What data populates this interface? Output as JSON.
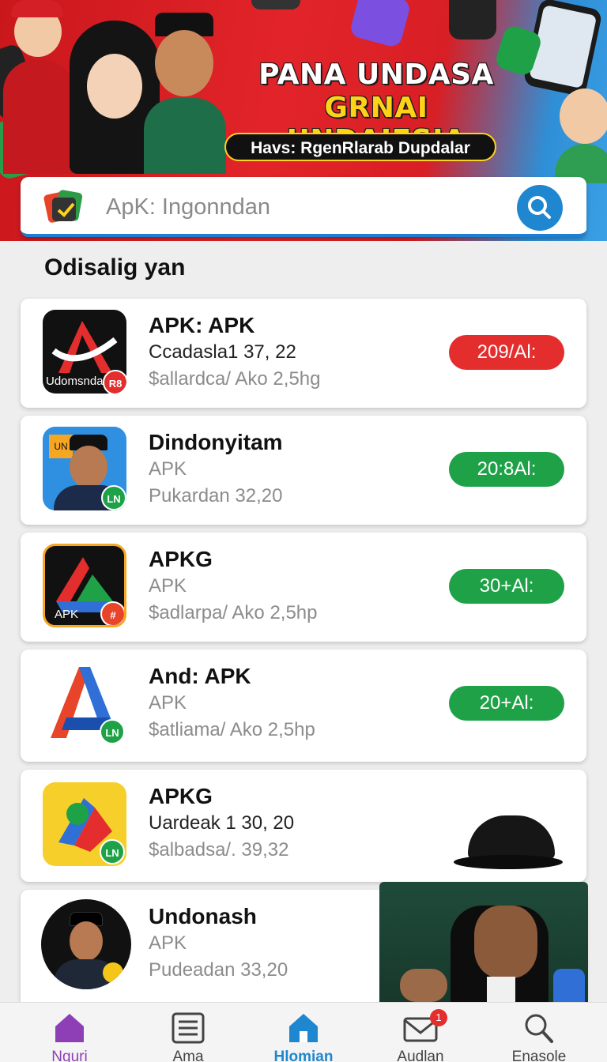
{
  "banner": {
    "title_line1": "PANA UNDASA",
    "title_line2": "GRNAI UNDAIESIA",
    "pill_text": "Havs: RgenRlarab Dupdalar"
  },
  "search": {
    "placeholder": "ApK: Ingonndan",
    "icon": "search-icon"
  },
  "section": {
    "title": "Odisalig yan"
  },
  "apps": [
    {
      "name": "APK: APK",
      "sub": "Ccadasla1 37, 22",
      "meta": "$allardca/ Ako 2,5hg",
      "action": "209/Al:",
      "action_color": "#e42d2d",
      "icon_label": "Udomsnda",
      "badge": "R8"
    },
    {
      "name": "Dindonyitam",
      "sub": "APK",
      "meta": "Pukardan 32,20",
      "action": "20:8Al:",
      "action_color": "#1fa247",
      "icon_label": "UN",
      "badge": "LN"
    },
    {
      "name": "APKG",
      "sub": "APK",
      "meta": "$adlarpa/ Ako 2,5hp",
      "action": "30+Al:",
      "action_color": "#1fa247",
      "icon_label": "APK",
      "badge": "#"
    },
    {
      "name": "And: APK",
      "sub": "APK",
      "meta": "$atliama/ Ako 2,5hp",
      "action": "20+Al:",
      "action_color": "#1fa247",
      "icon_label": "",
      "badge": "LN"
    },
    {
      "name": "APKG",
      "sub": "Uardeak 1 30, 20",
      "meta": "$albadsa/. 39,32",
      "action": "",
      "action_color": "#1fa247",
      "icon_label": "",
      "badge": "LN"
    },
    {
      "name": "Undonash",
      "sub": "APK",
      "meta": "Pudeadan 33,20",
      "action": "",
      "action_color": "#1fa247",
      "icon_label": "",
      "badge": ""
    }
  ],
  "bottom_nav": [
    {
      "label": "Nguri",
      "icon": "home-icon"
    },
    {
      "label": "Ama",
      "icon": "list-icon"
    },
    {
      "label": "Hlomian",
      "icon": "home-icon"
    },
    {
      "label": "Audlan",
      "icon": "mail-icon",
      "badge": "1"
    },
    {
      "label": "Enasole",
      "icon": "search-icon"
    }
  ],
  "colors": {
    "accent": "#1e87cf",
    "banner_red": "#d81f25",
    "title_yellow": "#ffd21a",
    "status_red": "#e42d2d",
    "status_green": "#1fa247",
    "nav_first": "#8e3fb5"
  }
}
